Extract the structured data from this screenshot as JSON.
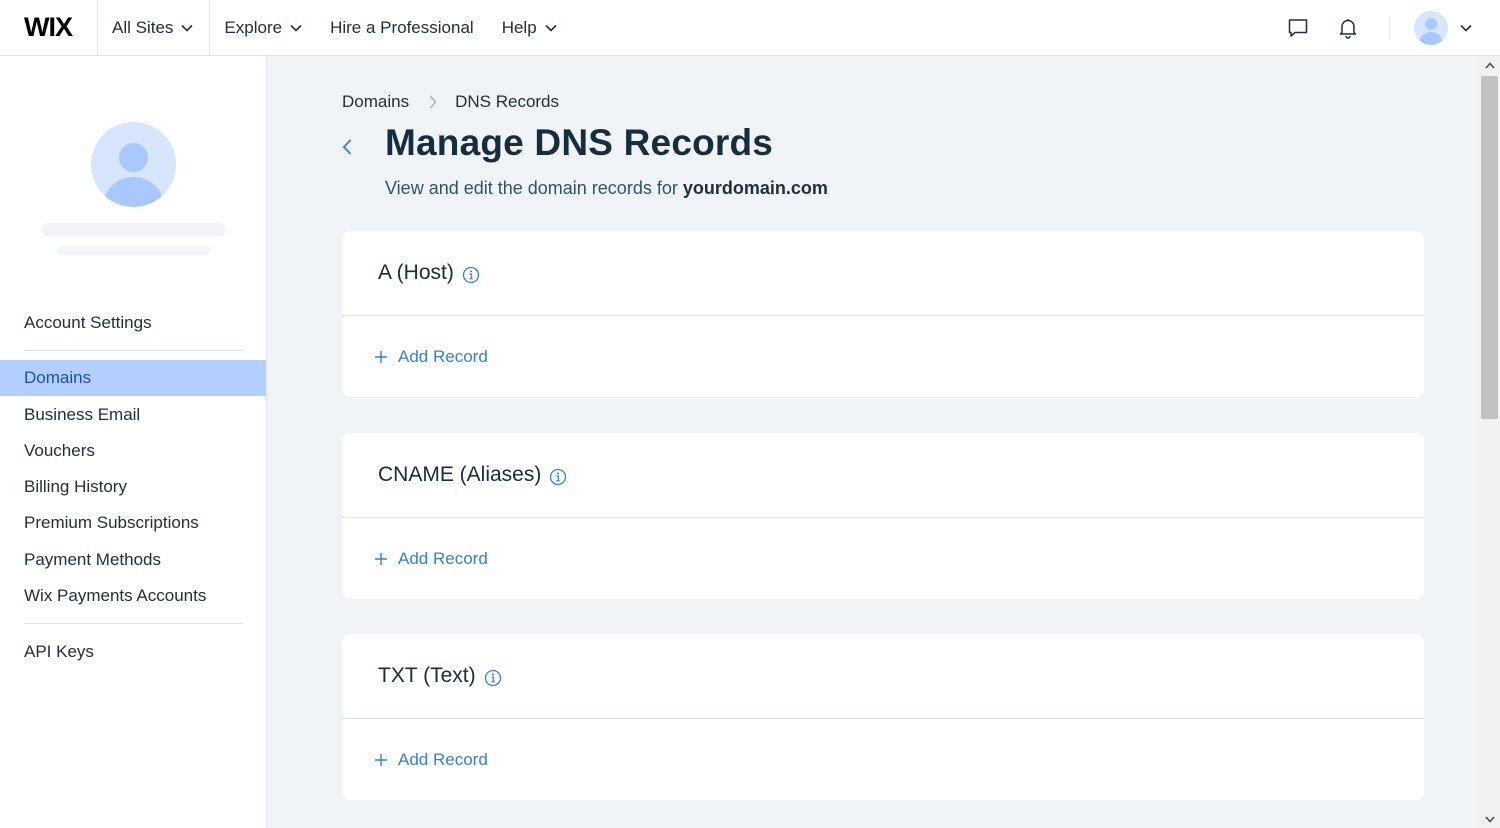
{
  "header": {
    "logo": "WIX",
    "nav": [
      {
        "label": "All Sites",
        "has_dropdown": true
      },
      {
        "label": "Explore",
        "has_dropdown": true
      },
      {
        "label": "Hire a Professional",
        "has_dropdown": false
      },
      {
        "label": "Help",
        "has_dropdown": true
      }
    ],
    "icons": [
      "chat-icon",
      "bell-icon",
      "avatar",
      "chevron-down-icon"
    ]
  },
  "sidebar": {
    "items": [
      {
        "label": "Account Settings"
      },
      {
        "label": "Domains",
        "active": true
      },
      {
        "label": "Business Email"
      },
      {
        "label": "Vouchers"
      },
      {
        "label": "Billing History"
      },
      {
        "label": "Premium Subscriptions"
      },
      {
        "label": "Payment Methods"
      },
      {
        "label": "Wix Payments Accounts"
      },
      {
        "label": "API Keys"
      }
    ]
  },
  "main": {
    "breadcrumb": [
      "Domains",
      "DNS Records"
    ],
    "title": "Manage DNS Records",
    "subtitle_prefix": "View and edit the domain records for",
    "domain": "yourdomain.com",
    "cards": [
      {
        "title": "A (Host)",
        "action": "Add Record"
      },
      {
        "title": "CNAME (Aliases)",
        "action": "Add Record"
      },
      {
        "title": "TXT (Text)",
        "action": "Add Record"
      }
    ]
  },
  "colors": {
    "accent": "#3480d8",
    "active_nav_bg": "#b3cfff",
    "active_nav_text": "#1d4fb5",
    "page_bg": "#f0f4f7",
    "title": "#162d3d"
  }
}
